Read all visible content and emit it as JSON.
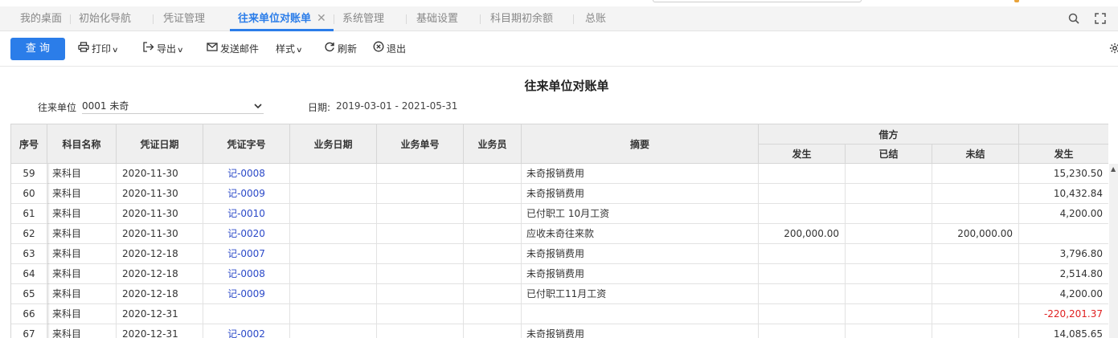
{
  "tabs": [
    {
      "label": "我的桌面",
      "active": false
    },
    {
      "label": "初始化导航",
      "active": false
    },
    {
      "label": "凭证管理",
      "active": false
    },
    {
      "label": "往来单位对账单",
      "active": true
    },
    {
      "label": "系统管理",
      "active": false
    },
    {
      "label": "基础设置",
      "active": false
    },
    {
      "label": "科目期初余额",
      "active": false
    },
    {
      "label": "总账",
      "active": false
    }
  ],
  "tab_close_glyph": "✕",
  "toolbar": {
    "query_label": "查 询",
    "print_label": "打印",
    "export_label": "导出",
    "email_label": "发送邮件",
    "style_label": "样式",
    "refresh_label": "刷新",
    "exit_label": "退出"
  },
  "report": {
    "title": "往来单位对账单",
    "unit_label": "往来单位",
    "unit_value": "0001 未奇",
    "date_label": "日期:",
    "date_value": "2019-03-01 - 2021-05-31"
  },
  "table": {
    "headers": {
      "seq": "序号",
      "account": "科目名称",
      "voucher_date": "凭证日期",
      "voucher_no": "凭证字号",
      "biz_date": "业务日期",
      "biz_no": "业务单号",
      "staff": "业务员",
      "summary": "摘要",
      "debit_group": "借方",
      "debit_amount": "发生",
      "debit_settled": "已结",
      "debit_unsettled": "未结",
      "credit_amount": "发生"
    },
    "rows": [
      {
        "seq": "59",
        "account": "来科目",
        "date": "2020-11-30",
        "voucher": "记-0008",
        "summary": "未奇报销费用",
        "debit": "",
        "settled": "",
        "unsettled": "",
        "credit": "15,230.50",
        "negative": false
      },
      {
        "seq": "60",
        "account": "来科目",
        "date": "2020-11-30",
        "voucher": "记-0009",
        "summary": "未奇报销费用",
        "debit": "",
        "settled": "",
        "unsettled": "",
        "credit": "10,432.84",
        "negative": false
      },
      {
        "seq": "61",
        "account": "来科目",
        "date": "2020-11-30",
        "voucher": "记-0010",
        "summary": "已付职工 10月工资",
        "debit": "",
        "settled": "",
        "unsettled": "",
        "credit": "4,200.00",
        "negative": false
      },
      {
        "seq": "62",
        "account": "来科目",
        "date": "2020-11-30",
        "voucher": "记-0020",
        "summary": "应收未奇往来款",
        "debit": "200,000.00",
        "settled": "",
        "unsettled": "200,000.00",
        "credit": "",
        "negative": false
      },
      {
        "seq": "63",
        "account": "来科目",
        "date": "2020-12-18",
        "voucher": "记-0007",
        "summary": "未奇报销费用",
        "debit": "",
        "settled": "",
        "unsettled": "",
        "credit": "3,796.80",
        "negative": false
      },
      {
        "seq": "64",
        "account": "来科目",
        "date": "2020-12-18",
        "voucher": "记-0008",
        "summary": "未奇报销费用",
        "debit": "",
        "settled": "",
        "unsettled": "",
        "credit": "2,514.80",
        "negative": false
      },
      {
        "seq": "65",
        "account": "来科目",
        "date": "2020-12-18",
        "voucher": "记-0009",
        "summary": "已付职工11月工资",
        "debit": "",
        "settled": "",
        "unsettled": "",
        "credit": "4,200.00",
        "negative": false
      },
      {
        "seq": "66",
        "account": "来科目",
        "date": "2020-12-31",
        "voucher": "",
        "summary": "",
        "debit": "",
        "settled": "",
        "unsettled": "",
        "credit": "-220,201.37",
        "negative": true
      },
      {
        "seq": "67",
        "account": "来科目",
        "date": "2020-12-31",
        "voucher": "记-0002",
        "summary": "未奇报销费用",
        "debit": "",
        "settled": "",
        "unsettled": "",
        "credit": "14,085.65",
        "negative": false
      }
    ]
  },
  "colors": {
    "accent": "#2b7de9",
    "link": "#2b49c8",
    "negative": "#e02020",
    "header_bg": "#efefef"
  }
}
